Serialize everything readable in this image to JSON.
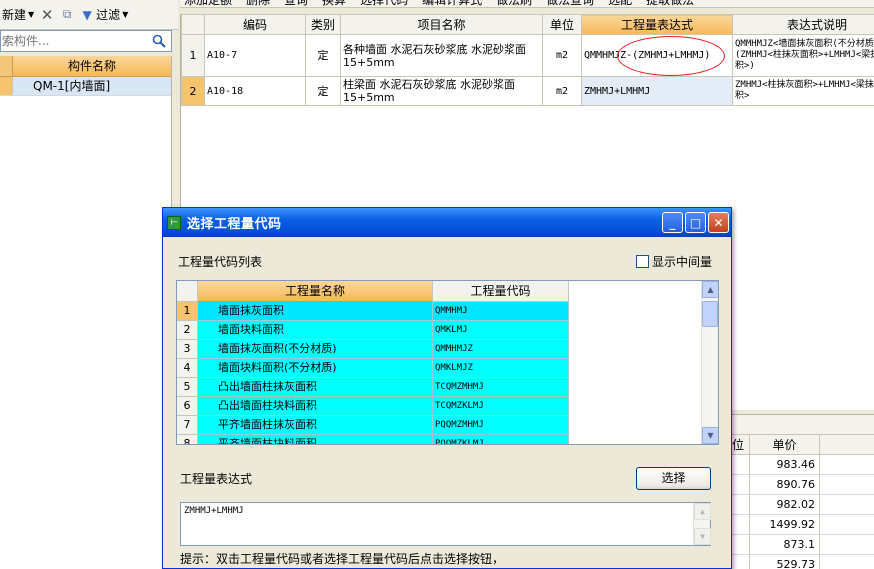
{
  "left_toolbar": {
    "new_label": "新建",
    "filter_label": "过滤"
  },
  "left_search": {
    "placeholder": "索构件..."
  },
  "component_list": {
    "header": "构件名称",
    "rows": [
      {
        "name": "QM-1[内墙面]"
      }
    ]
  },
  "right_toolbar": {
    "items": [
      "添加定额",
      "删除",
      "查询",
      "换算",
      "选择代码",
      "编辑计算式",
      "做法刷",
      "做法查询",
      "选配",
      "提取做法"
    ]
  },
  "main_grid": {
    "headers": {
      "code": "编码",
      "type": "类别",
      "name": "项目名称",
      "unit": "单位",
      "expression": "工程量表达式",
      "desc": "表达式说明"
    },
    "rows": [
      {
        "no": "1",
        "code": "A10-7",
        "type": "定",
        "name": "各种墙面 水泥石灰砂浆底 水泥砂浆面 15+5mm",
        "unit": "m2",
        "expression": "QMMHMJZ-(ZMHMJ+LMHMJ)",
        "desc": "QMMHMJZ<墙面抹灰面积(不分材质)>-(ZMHMJ<柱抹灰面积>+LMHMJ<梁抹灰面积>)"
      },
      {
        "no": "2",
        "code": "A10-18",
        "type": "定",
        "name": "柱梁面 水泥石灰砂浆底 水泥砂浆面 15+5mm",
        "unit": "m2",
        "expression": "ZMHMJ+LMHMJ",
        "desc": "ZMHMJ<柱抹灰面积>+LMHMJ<梁抹灰面积>"
      }
    ]
  },
  "bottom_grid": {
    "col_partial": "位",
    "price_header": "单价",
    "prices": [
      "983.46",
      "890.76",
      "982.02",
      "1499.92",
      "873.1",
      "529.73"
    ]
  },
  "dialog": {
    "title": "选择工程量代码",
    "list_label": "工程量代码列表",
    "show_intermediate_label": "显示中间量",
    "show_intermediate_checked": false,
    "table": {
      "name_header": "工程量名称",
      "code_header": "工程量代码",
      "rows": [
        {
          "no": "1",
          "name": "墙面抹灰面积",
          "code": "QMMHMJ"
        },
        {
          "no": "2",
          "name": "墙面块料面积",
          "code": "QMKLMJ"
        },
        {
          "no": "3",
          "name": "墙面抹灰面积(不分材质)",
          "code": "QMMHMJZ"
        },
        {
          "no": "4",
          "name": "墙面块料面积(不分材质)",
          "code": "QMKLMJZ"
        },
        {
          "no": "5",
          "name": "凸出墙面柱抹灰面积",
          "code": "TCQMZMHMJ"
        },
        {
          "no": "6",
          "name": "凸出墙面柱块料面积",
          "code": "TCQMZKLMJ"
        },
        {
          "no": "7",
          "name": "平齐墙面柱抹灰面积",
          "code": "PQQMZMHMJ"
        },
        {
          "no": "8",
          "name": "平齐墙面柱块料面积",
          "code": "PQQMZKLMJ"
        }
      ]
    },
    "expression_label": "工程量表达式",
    "select_button": "选择",
    "expression_value": "ZMHMJ+LMHMJ",
    "hint": "提示：双击工程量代码或者选择工程量代码后点击选择按钮，"
  },
  "colors": {
    "title_bar": "#0a5fe6",
    "orange_header": "#f6b95a",
    "cyan_rows": "#00ffff",
    "annotation_oval": "#e0221b"
  }
}
